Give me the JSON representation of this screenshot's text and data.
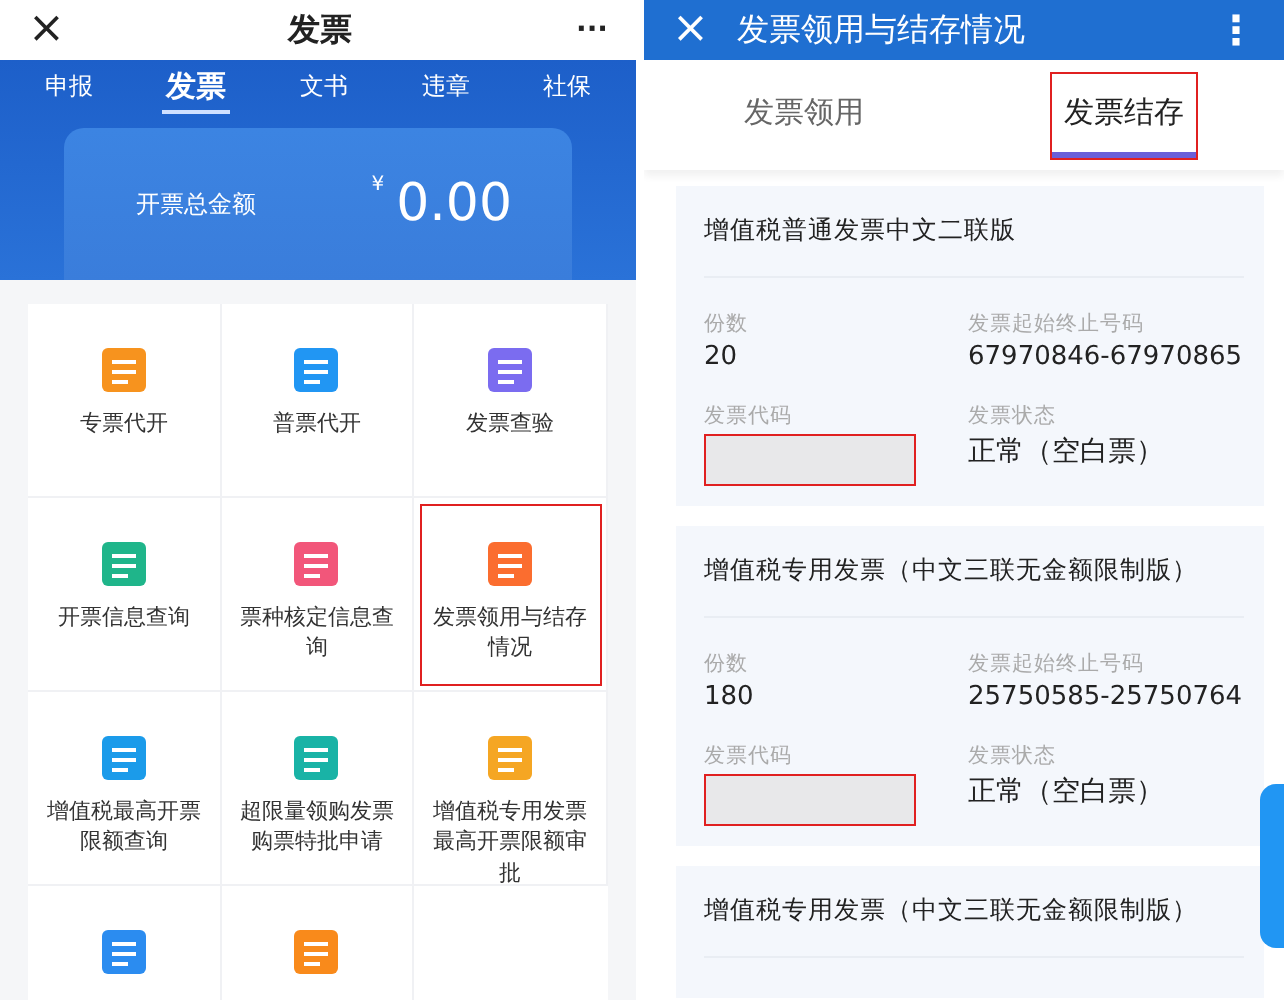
{
  "left_screen": {
    "close": "×",
    "title": "发票",
    "more": "···",
    "tabs": [
      {
        "label": "申报",
        "selected": false
      },
      {
        "label": "发票",
        "selected": true
      },
      {
        "label": "文书",
        "selected": false
      },
      {
        "label": "违章",
        "selected": false
      },
      {
        "label": "社保",
        "selected": false
      }
    ],
    "amount": {
      "label": "开票总金额",
      "currency": "¥",
      "value": "0.00"
    },
    "services": [
      {
        "label": "专票代开",
        "color": "#f7931e",
        "highlighted": false
      },
      {
        "label": "普票代开",
        "color": "#2196f3",
        "highlighted": false
      },
      {
        "label": "发票查验",
        "color": "#7b6cf0",
        "highlighted": false
      },
      {
        "label": "开票信息查询",
        "color": "#1fb58a",
        "highlighted": false
      },
      {
        "label": "票种核定信息查询",
        "color": "#f2567a",
        "highlighted": false
      },
      {
        "label": "发票领用与结存情况",
        "color": "#fb6d2f",
        "highlighted": true
      },
      {
        "label": "增值税最高开票限额查询",
        "color": "#1b9bea",
        "highlighted": false
      },
      {
        "label": "超限量领购发票购票特批申请",
        "color": "#19b3a6",
        "highlighted": false
      },
      {
        "label": "增值税专用发票最高开票限额审批",
        "color": "#f5a623",
        "highlighted": false
      },
      {
        "color": "#2b8cf0",
        "highlighted": false
      },
      {
        "color": "#f98a1b",
        "highlighted": false
      }
    ]
  },
  "right_screen": {
    "close": "×",
    "title": "发票领用与结存情况",
    "more": "⋮",
    "tabs": [
      {
        "label": "发票领用",
        "selected": false,
        "highlighted": false
      },
      {
        "label": "发票结存",
        "selected": true,
        "highlighted": true
      }
    ],
    "cards": [
      {
        "title": "增值税普通发票中文二联版",
        "count_label": "份数",
        "count": "20",
        "range_label": "发票起始终止号码",
        "range": "67970846-67970865",
        "code_label": "发票代码",
        "code_redacted": true,
        "status_label": "发票状态",
        "status": "正常（空白票）"
      },
      {
        "title": "增值税专用发票（中文三联无金额限制版）",
        "count_label": "份数",
        "count": "180",
        "range_label": "发票起始终止号码",
        "range": "25750585-25750764",
        "code_label": "发票代码",
        "code_redacted": true,
        "status_label": "发票状态",
        "status": "正常（空白票）"
      },
      {
        "title": "增值税专用发票（中文三联无金额限制版）"
      }
    ]
  }
}
